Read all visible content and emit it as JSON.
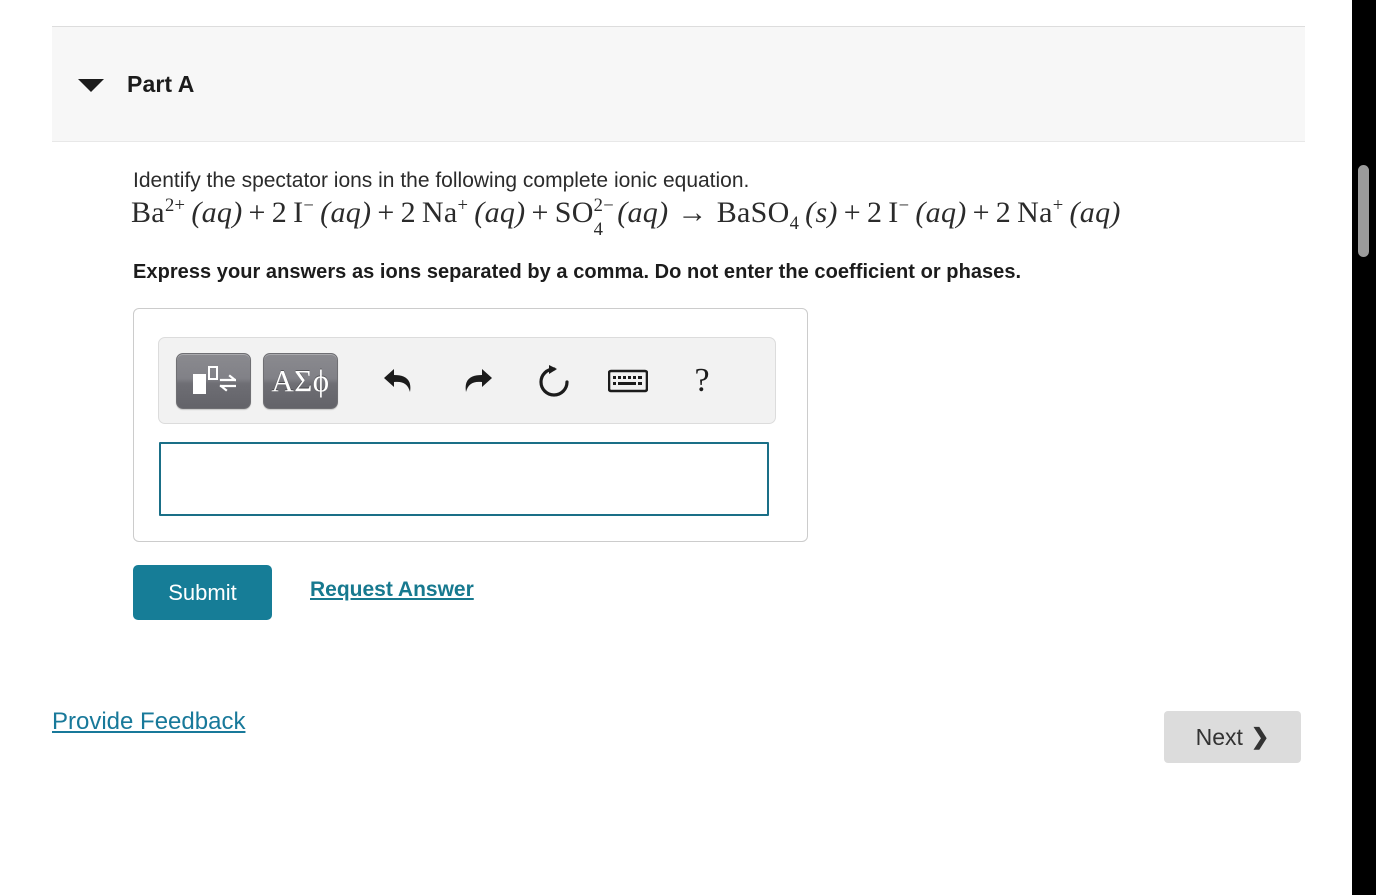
{
  "part": {
    "title": "Part A",
    "disclosure_icon": "triangle-down-icon",
    "expanded": true
  },
  "question": {
    "prompt": "Identify the spectator ions in the following complete ionic equation.",
    "equation_plain": "Ba2+ (aq) + 2 I- (aq) + 2 Na+ (aq) + SO4 2- (aq) → BaSO4 (s) + 2 I- (aq) + 2 Na+ (aq)",
    "equation_parts": {
      "ba": "Ba",
      "ba_charge": "2+",
      "aq1": "(aq)",
      "plus1": "+",
      "coef_i1": "2",
      "i1": "I",
      "i1_charge": "−",
      "aq2": "(aq)",
      "plus2": "+",
      "coef_na1": "2",
      "na1": "Na",
      "na1_charge": "+",
      "aq3": "(aq)",
      "plus3": "+",
      "so": "SO",
      "so_sup": "2−",
      "so_sub": "4",
      "aq4": "(aq)",
      "arrow": "→",
      "baso4": "BaSO",
      "baso4_sub": "4",
      "s_phase": "(s)",
      "plus4": "+",
      "coef_i2": "2",
      "i2": "I",
      "i2_charge": "−",
      "aq5": "(aq)",
      "plus5": "+",
      "coef_na2": "2",
      "na2": "Na",
      "na2_charge": "+",
      "aq6": "(aq)"
    },
    "instruction": "Express your answers as ions separated by a comma. Do not enter the coefficient or phases."
  },
  "answer_panel": {
    "toolbar": {
      "template_button": {
        "icon": "chemistry-template-icon",
        "label": ""
      },
      "greek_button": {
        "icon": "greek-symbols-icon",
        "label": "ΑΣϕ"
      },
      "undo": {
        "icon": "undo-arrow-icon",
        "label": ""
      },
      "redo": {
        "icon": "redo-arrow-icon",
        "label": ""
      },
      "reset": {
        "icon": "reset-circular-arrow-icon",
        "label": ""
      },
      "keyboard": {
        "icon": "keyboard-icon",
        "label": ""
      },
      "help": {
        "icon": "question-mark-icon",
        "label": "?"
      }
    },
    "input": {
      "value": "",
      "placeholder": ""
    }
  },
  "actions": {
    "submit_label": "Submit",
    "request_answer_label": "Request Answer"
  },
  "footer": {
    "provide_feedback_label": "Provide Feedback",
    "next_label": "Next",
    "next_chevron": "❯"
  },
  "colors": {
    "teal_accent": "#167d97",
    "link_teal": "#17798f",
    "feedback_link": "#18799a",
    "input_border": "#1a6f87",
    "panel_bg": "#f7f7f7",
    "next_button_bg": "#dcdcdc",
    "scrollbar_thumb": "#9b9b9b"
  },
  "scrollbar": {
    "thumb_position_pct": 19,
    "orientation": "vertical"
  }
}
